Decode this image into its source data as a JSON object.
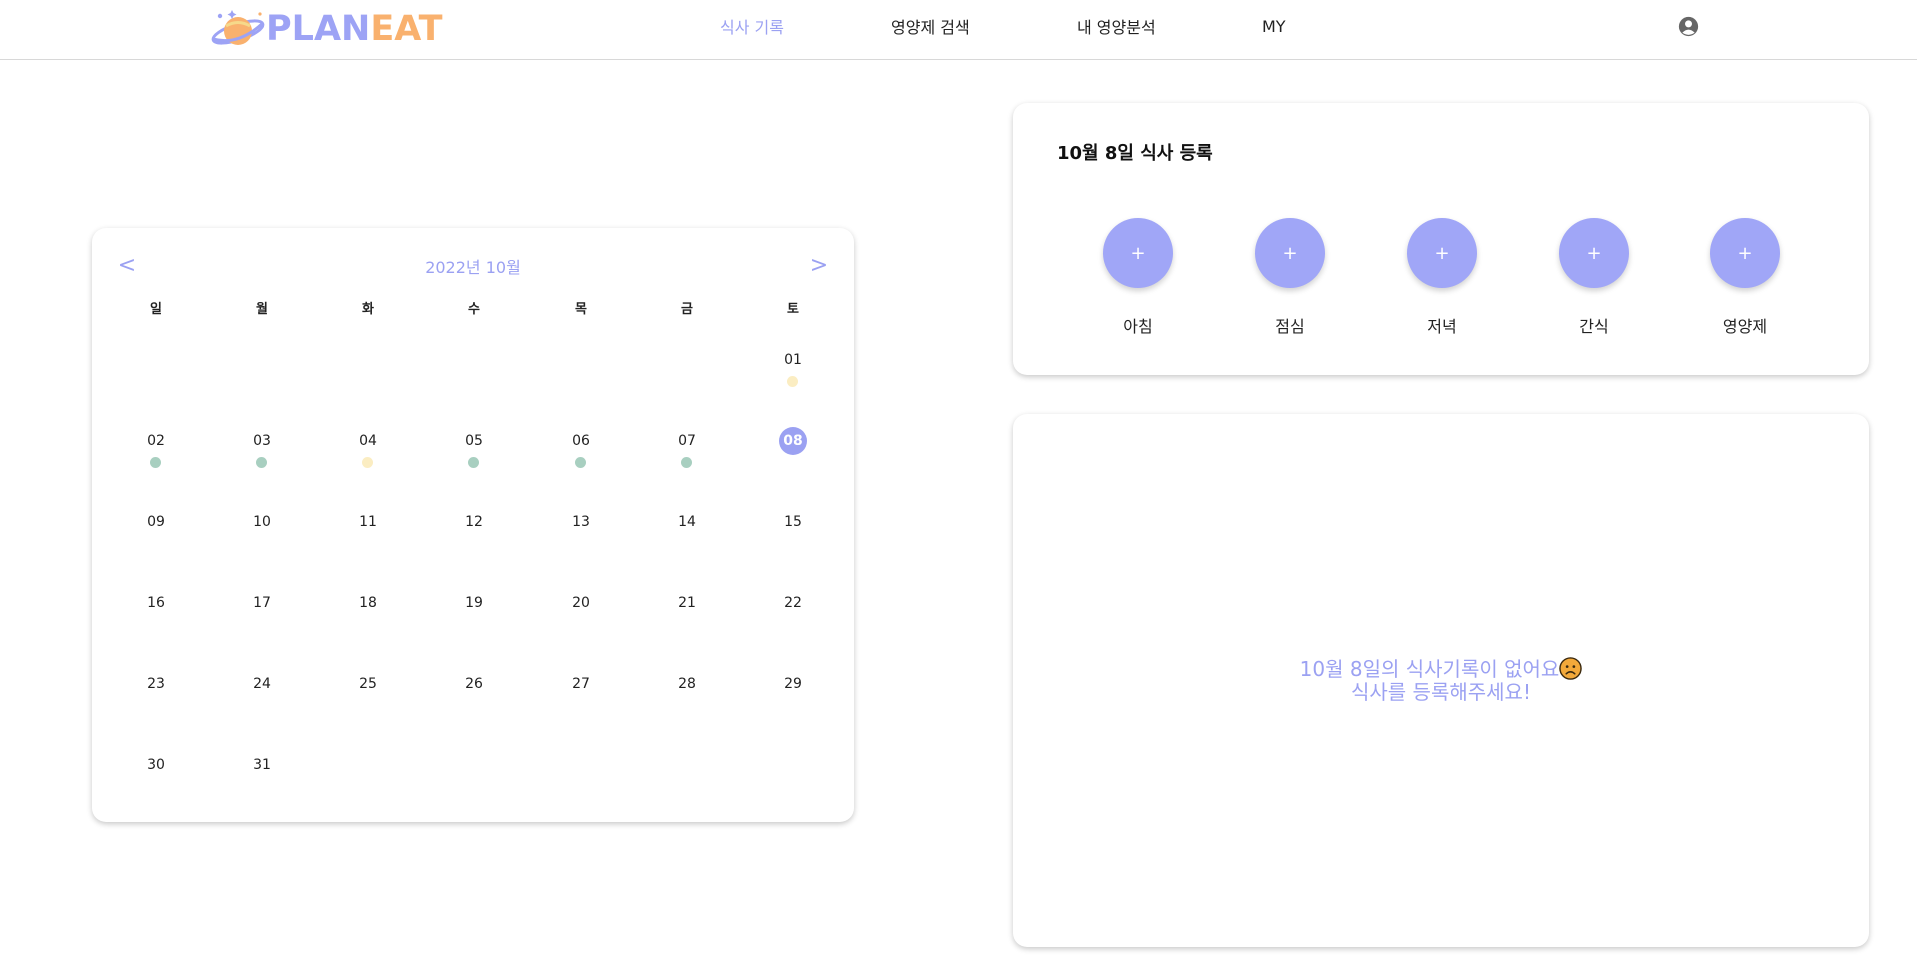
{
  "header": {
    "logo": {
      "plan": "PLAN",
      "eat": "EAT",
      "icon": "planet-logo-icon"
    },
    "nav": [
      {
        "label": "식사 기록",
        "active": true
      },
      {
        "label": "영양제 검색",
        "active": false
      },
      {
        "label": "내 영양분석",
        "active": false
      },
      {
        "label": "MY",
        "active": false
      }
    ],
    "profile_icon": "user-circle-icon"
  },
  "calendar": {
    "title": "2022년 10월",
    "prev": "<",
    "next": ">",
    "weekdays": [
      "일",
      "월",
      "화",
      "수",
      "목",
      "금",
      "토"
    ],
    "days": [
      {
        "label": "01",
        "dot": "yellow"
      },
      {
        "label": "02",
        "dot": "green"
      },
      {
        "label": "03",
        "dot": "green"
      },
      {
        "label": "04",
        "dot": "yellow"
      },
      {
        "label": "05",
        "dot": "green"
      },
      {
        "label": "06",
        "dot": "green"
      },
      {
        "label": "07",
        "dot": "green"
      },
      {
        "label": "08",
        "dot": null,
        "selected": true
      },
      {
        "label": "09"
      },
      {
        "label": "10"
      },
      {
        "label": "11"
      },
      {
        "label": "12"
      },
      {
        "label": "13"
      },
      {
        "label": "14"
      },
      {
        "label": "15"
      },
      {
        "label": "16"
      },
      {
        "label": "17"
      },
      {
        "label": "18"
      },
      {
        "label": "19"
      },
      {
        "label": "20"
      },
      {
        "label": "21"
      },
      {
        "label": "22"
      },
      {
        "label": "23"
      },
      {
        "label": "24"
      },
      {
        "label": "25"
      },
      {
        "label": "26"
      },
      {
        "label": "27"
      },
      {
        "label": "28"
      },
      {
        "label": "29"
      },
      {
        "label": "30"
      },
      {
        "label": "31"
      }
    ],
    "dot_colors": {
      "green": "#a8cfc0",
      "yellow": "#fbedc2"
    },
    "accent": "#9ba1f2"
  },
  "register": {
    "title": "10월 8일 식사 등록",
    "meals": [
      {
        "plus": "+",
        "label": "아침"
      },
      {
        "plus": "+",
        "label": "점심"
      },
      {
        "plus": "+",
        "label": "저녁"
      },
      {
        "plus": "+",
        "label": "간식"
      },
      {
        "plus": "+",
        "label": "영양제"
      }
    ]
  },
  "records": {
    "empty_line1": "10월 8일의 식사기록이 없어요",
    "empty_icon": "sad-face-icon",
    "empty_line2": "식사를 등록해주세요!"
  }
}
